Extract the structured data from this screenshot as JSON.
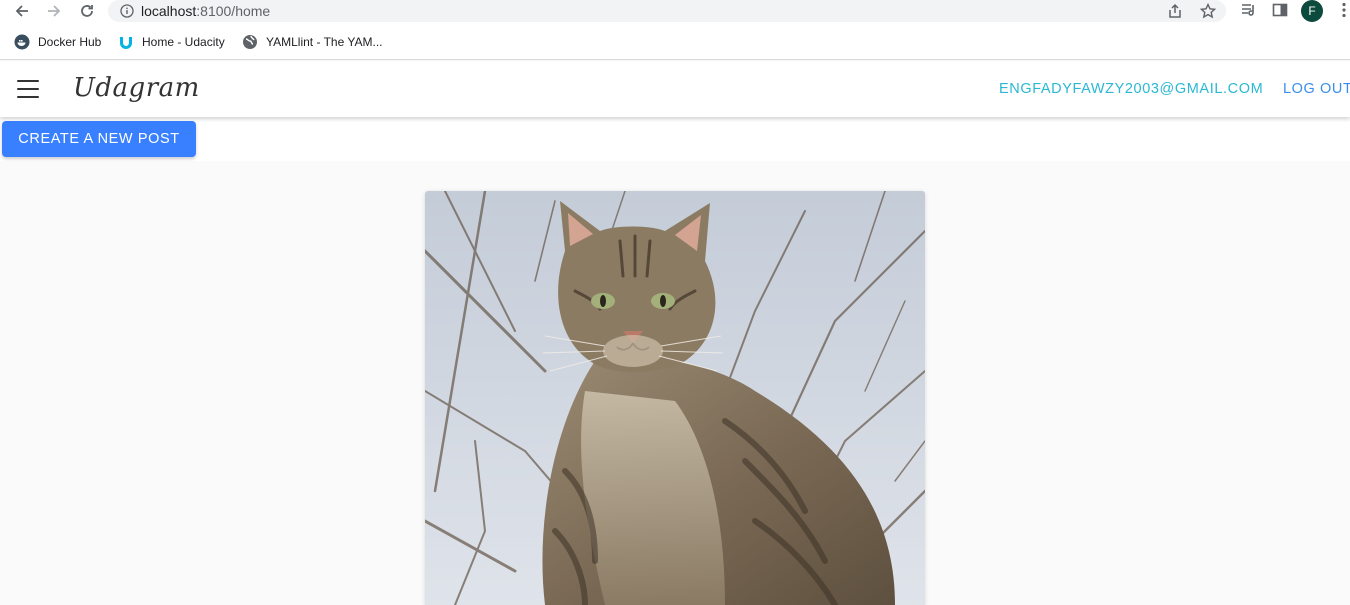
{
  "browser": {
    "url_host": "localhost",
    "url_path": ":8100/home",
    "profile_initial": "F",
    "bookmarks": [
      {
        "label": "Docker Hub",
        "icon": "docker-icon"
      },
      {
        "label": "Home - Udacity",
        "icon": "udacity-icon"
      },
      {
        "label": "YAMLlint - The YAM...",
        "icon": "globe-icon"
      }
    ]
  },
  "header": {
    "brand": "Udagram",
    "user_email": "ENGFADYFAWZY2003@GMAIL.COM",
    "logout_label": "LOG OUT"
  },
  "main": {
    "create_post_label": "CREATE A NEW POST"
  },
  "colors": {
    "accent": "#3880ff",
    "email": "#2ab8d4",
    "logout": "#3b8ee8"
  }
}
